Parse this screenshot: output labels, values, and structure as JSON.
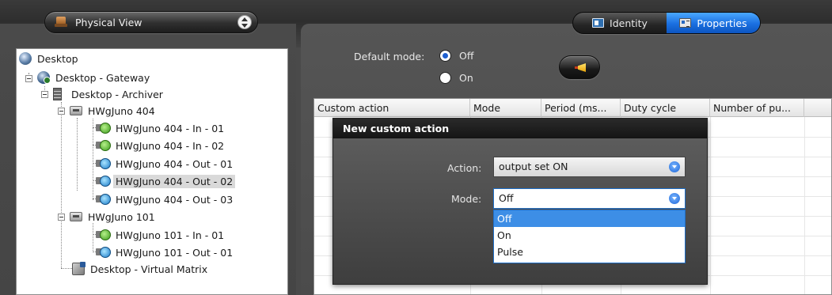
{
  "view_selector": {
    "label": "Physical View"
  },
  "tabs": [
    {
      "label": "Identity",
      "icon": "id-card-icon",
      "active": false
    },
    {
      "label": "Properties",
      "icon": "properties-icon",
      "active": true
    }
  ],
  "tree": {
    "nodes": [
      {
        "label": "Desktop",
        "icon": "globe-icon"
      },
      {
        "label": "Desktop - Gateway",
        "icon": "gateway-icon"
      },
      {
        "label": "Desktop - Archiver",
        "icon": "server-icon"
      },
      {
        "label": "HWgJuno 404",
        "icon": "device-icon"
      },
      {
        "label": "HWgJuno 404 - In - 01",
        "icon": "input-icon"
      },
      {
        "label": "HWgJuno 404 - In - 02",
        "icon": "input-icon"
      },
      {
        "label": "HWgJuno 404 - Out - 01",
        "icon": "output-icon"
      },
      {
        "label": "HWgJuno 404 - Out - 02",
        "icon": "output-icon",
        "selected": true
      },
      {
        "label": "HWgJuno 404 - Out - 03",
        "icon": "output-icon"
      },
      {
        "label": "HWgJuno 101",
        "icon": "device-icon"
      },
      {
        "label": "HWgJuno 101 - In - 01",
        "icon": "input-icon"
      },
      {
        "label": "HWgJuno 101 - Out - 01",
        "icon": "output-icon"
      },
      {
        "label": "Desktop - Virtual Matrix",
        "icon": "virtual-matrix-icon"
      }
    ]
  },
  "default_mode": {
    "label": "Default mode:",
    "options": [
      {
        "label": "Off",
        "checked": true
      },
      {
        "label": "On",
        "checked": false
      }
    ]
  },
  "trigger_button": {
    "icon": "horn-icon"
  },
  "grid": {
    "columns": [
      "Custom action",
      "Mode",
      "Period (ms...",
      "Duty cycle",
      "Number of pu..."
    ]
  },
  "dialog": {
    "title": "New custom action",
    "action_label": "Action:",
    "action_value": "output set ON",
    "mode_label": "Mode:",
    "mode_value": "Off",
    "mode_options": [
      {
        "label": "Off",
        "selected": true
      },
      {
        "label": "On",
        "selected": false
      },
      {
        "label": "Pulse",
        "selected": false
      }
    ]
  }
}
